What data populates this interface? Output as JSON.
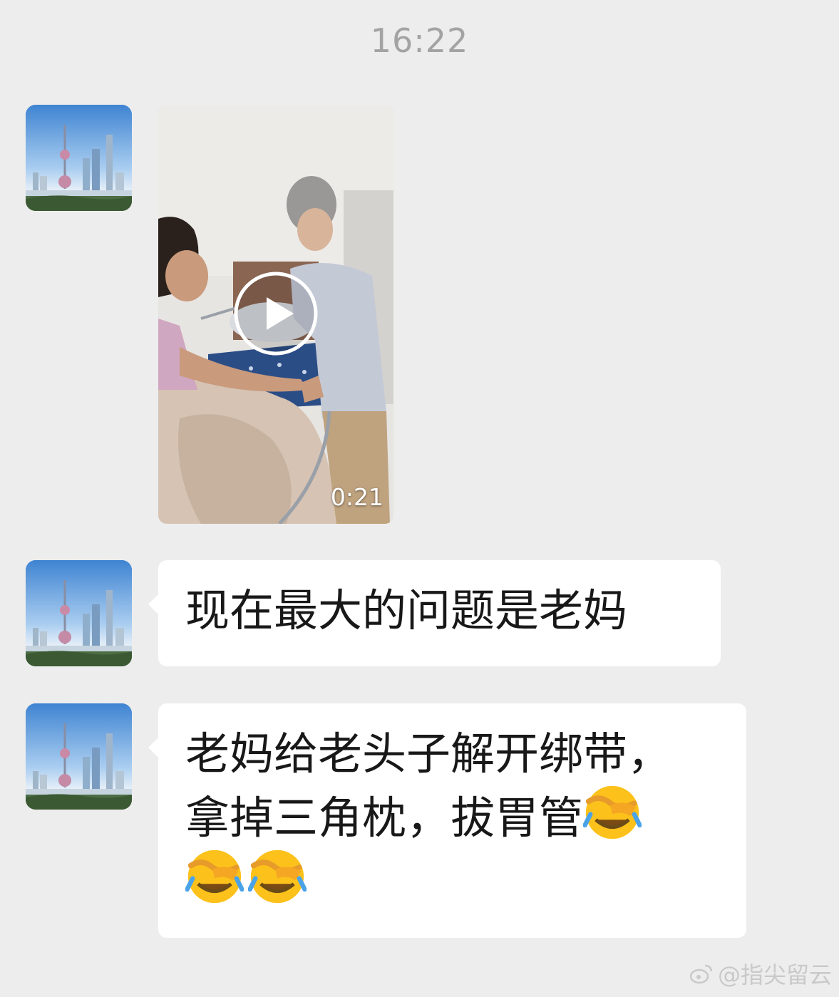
{
  "timestamp": "16:22",
  "messages": [
    {
      "type": "video",
      "duration": "0:21"
    },
    {
      "type": "text",
      "text": "现在最大的问题是老妈"
    },
    {
      "type": "text",
      "lines": [
        "老妈给老头子解开绑带，",
        "拿掉三角枕，拔胃管"
      ]
    }
  ],
  "emoji": "face-with-tears-of-joy-covering-eyes",
  "watermark": "@指尖留云",
  "colors": {
    "background": "#ededed",
    "bubble": "#ffffff",
    "timestamp": "#a3a3a3"
  }
}
